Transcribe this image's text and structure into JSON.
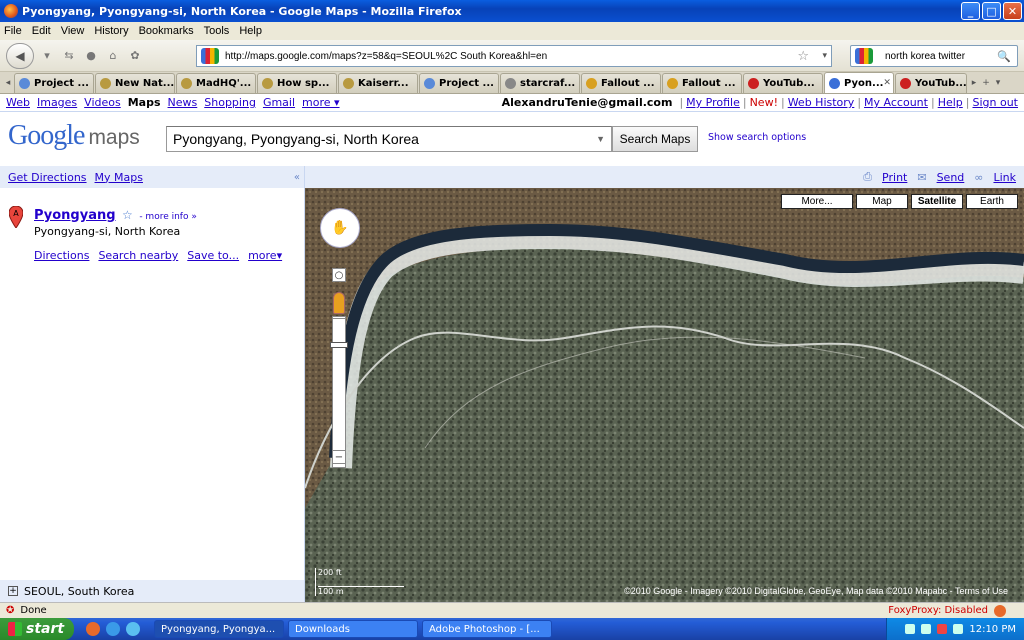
{
  "window": {
    "title": "Pyongyang, Pyongyang-si, North Korea - Google Maps - Mozilla Firefox"
  },
  "menu": [
    "File",
    "Edit",
    "View",
    "History",
    "Bookmarks",
    "Tools",
    "Help"
  ],
  "nav": {
    "url": "http://maps.google.com/maps?z=58&q=SEOUL%2C South Korea&hl=en",
    "search_query": "north korea twitter"
  },
  "tabs": [
    {
      "label": "Project ...",
      "color": "#5a8ad8"
    },
    {
      "label": "New Nat...",
      "color": "#b89a40"
    },
    {
      "label": "MadHQ'...",
      "color": "#b89a40"
    },
    {
      "label": "How sp...",
      "color": "#b89a40"
    },
    {
      "label": "Kaiserr...",
      "color": "#b89a40"
    },
    {
      "label": "Project ...",
      "color": "#5a8ad8"
    },
    {
      "label": "starcraf...",
      "color": "#888888"
    },
    {
      "label": "Fallout ...",
      "color": "#d8a020"
    },
    {
      "label": "Fallout ...",
      "color": "#d8a020"
    },
    {
      "label": "YouTub...",
      "color": "#cc2020"
    },
    {
      "label": "Pyon...",
      "color": "#3a6fd8",
      "active": true
    },
    {
      "label": "YouTub...",
      "color": "#cc2020"
    }
  ],
  "gbar": {
    "links": [
      "Web",
      "Images",
      "Videos",
      "Maps",
      "News",
      "Shopping",
      "Gmail",
      "more ▾"
    ],
    "email": "AlexandruTenie@gmail.com",
    "right_links": [
      "My Profile",
      "New!",
      "Web History",
      "My Account",
      "Help",
      "Sign out"
    ]
  },
  "header": {
    "logo_google": "Google",
    "logo_maps": "maps",
    "search_value": "Pyongyang, Pyongyang-si, North Korea",
    "search_button": "Search Maps",
    "options_link": "Show search options"
  },
  "left": {
    "get_directions": "Get Directions",
    "my_maps": "My Maps",
    "collapse": "«",
    "result": {
      "marker": "A",
      "name": "Pyongyang",
      "more_info": "- more info »",
      "address": "Pyongyang-si, North Korea"
    },
    "actions": [
      "Directions",
      "Search nearby",
      "Save to...",
      "more▾"
    ],
    "bottom": "SEOUL, South Korea"
  },
  "maptools": {
    "print": "Print",
    "send": "Send",
    "link": "Link"
  },
  "map": {
    "types": [
      "More...",
      "Map",
      "Satellite",
      "Earth"
    ],
    "scale_ft": "200 ft",
    "scale_m": "100 m",
    "copyright": "©2010 Google - Imagery ©2010 DigitalGlobe, GeoEye, Map data ©2010 Mapabc - Terms of Use"
  },
  "status": {
    "text": "Done",
    "foxyproxy": "FoxyProxy: Disabled"
  },
  "taskbar": {
    "start": "start",
    "tasks": [
      "Pyongyang, Pyongya...",
      "Downloads",
      "Adobe Photoshop - [..."
    ],
    "clock": "12:10 PM"
  }
}
